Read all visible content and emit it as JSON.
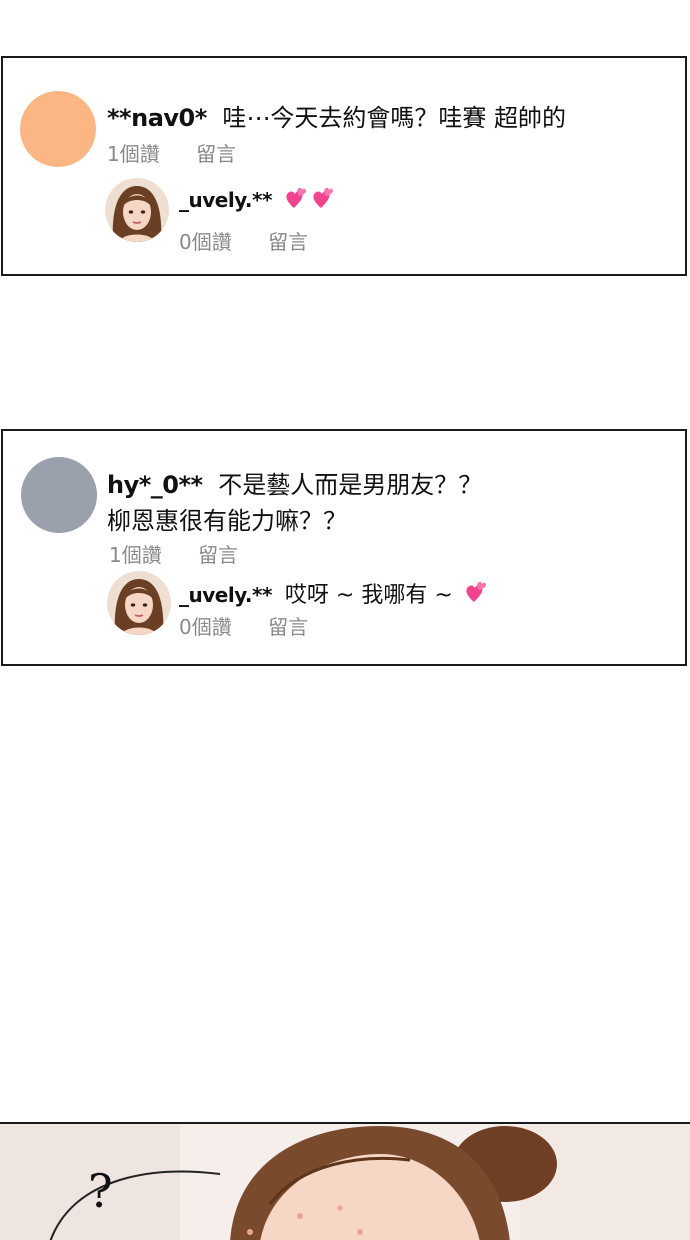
{
  "comments": [
    {
      "username": "**nav0*",
      "text": "哇⋯今天去約會嗎？哇賽 超帥的",
      "likes": "1個讚",
      "reply_label": "留言",
      "avatar_color": "#FBB684",
      "reply": {
        "username": "_uvely.**",
        "text": "",
        "emoji": "💕💕",
        "likes": "0個讚",
        "reply_label": "留言"
      }
    },
    {
      "username": "hy*_0**",
      "text_line1": "不是藝人而是男朋友？？",
      "text_line2": "柳恩惠很有能力嘛？？",
      "likes": "1個讚",
      "reply_label": "留言",
      "avatar_color": "#9AA0AC",
      "reply": {
        "username": "_uvely.**",
        "text": "哎呀 ~ 我哪有 ~",
        "emoji": "💕",
        "likes": "0個讚",
        "reply_label": "留言"
      }
    }
  ],
  "scene": {
    "question_mark": "?"
  },
  "colors": {
    "border": "#1a1a1a",
    "meta_text": "#8a8a8a",
    "heart": "#F0448F",
    "hair": "#7A4A2C",
    "skin": "#F6D6C4"
  }
}
